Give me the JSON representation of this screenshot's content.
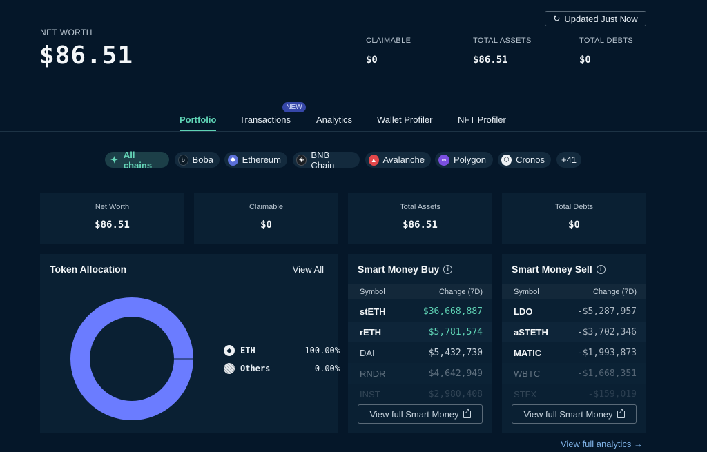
{
  "header": {
    "net_worth_label": "NET WORTH",
    "net_worth_value": "$86.51",
    "updated_label": "Updated Just Now",
    "stats": [
      {
        "label": "CLAIMABLE",
        "value": "$0"
      },
      {
        "label": "TOTAL ASSETS",
        "value": "$86.51"
      },
      {
        "label": "TOTAL DEBTS",
        "value": "$0"
      }
    ]
  },
  "tabs": {
    "items": [
      {
        "label": "Portfolio",
        "active": true
      },
      {
        "label": "Transactions",
        "badge": "NEW"
      },
      {
        "label": "Analytics"
      },
      {
        "label": "Wallet Profiler"
      },
      {
        "label": "NFT Profiler"
      }
    ]
  },
  "chains": {
    "items": [
      {
        "label": "All chains",
        "icon": "all-chains-icon",
        "active": true
      },
      {
        "label": "Boba",
        "icon": "boba-icon"
      },
      {
        "label": "Ethereum",
        "icon": "ethereum-icon"
      },
      {
        "label": "BNB Chain",
        "icon": "bnb-chain-icon"
      },
      {
        "label": "Avalanche",
        "icon": "avalanche-icon"
      },
      {
        "label": "Polygon",
        "icon": "polygon-icon"
      },
      {
        "label": "Cronos",
        "icon": "cronos-icon"
      }
    ],
    "more": "+41"
  },
  "summary_cards": [
    {
      "label": "Net Worth",
      "value": "$86.51"
    },
    {
      "label": "Claimable",
      "value": "$0"
    },
    {
      "label": "Total Assets",
      "value": "$86.51"
    },
    {
      "label": "Total Debts",
      "value": "$0"
    }
  ],
  "token_allocation": {
    "title": "Token Allocation",
    "view_all": "View All",
    "legend": [
      {
        "name": "ETH",
        "pct": "100.00%",
        "color": "#6b7cff"
      },
      {
        "name": "Others",
        "pct": "0.00%",
        "color": "#d9dde2"
      }
    ]
  },
  "smart_money_buy": {
    "title": "Smart Money Buy",
    "col_symbol": "Symbol",
    "col_change": "Change (7D)",
    "rows": [
      {
        "symbol": "stETH",
        "change": "$36,668,887"
      },
      {
        "symbol": "rETH",
        "change": "$5,781,574"
      },
      {
        "symbol": "DAI",
        "change": "$5,432,730"
      },
      {
        "symbol": "RNDR",
        "change": "$4,642,949"
      },
      {
        "symbol": "INST",
        "change": "$2,980,408"
      }
    ],
    "view_full": "View full Smart Money"
  },
  "smart_money_sell": {
    "title": "Smart Money Sell",
    "col_symbol": "Symbol",
    "col_change": "Change (7D)",
    "rows": [
      {
        "symbol": "LDO",
        "change": "-$5,287,957"
      },
      {
        "symbol": "aSTETH",
        "change": "-$3,702,346"
      },
      {
        "symbol": "MATIC",
        "change": "-$1,993,873"
      },
      {
        "symbol": "WBTC",
        "change": "-$1,668,351"
      },
      {
        "symbol": "STFX",
        "change": "-$159,019"
      }
    ],
    "view_full": "View full Smart Money"
  },
  "footer": {
    "view_full_analytics": "View full analytics →"
  },
  "colors": {
    "background": "#051729",
    "card": "#0a2033",
    "accent": "#5fd3b5",
    "donut": "#6b7cff"
  }
}
